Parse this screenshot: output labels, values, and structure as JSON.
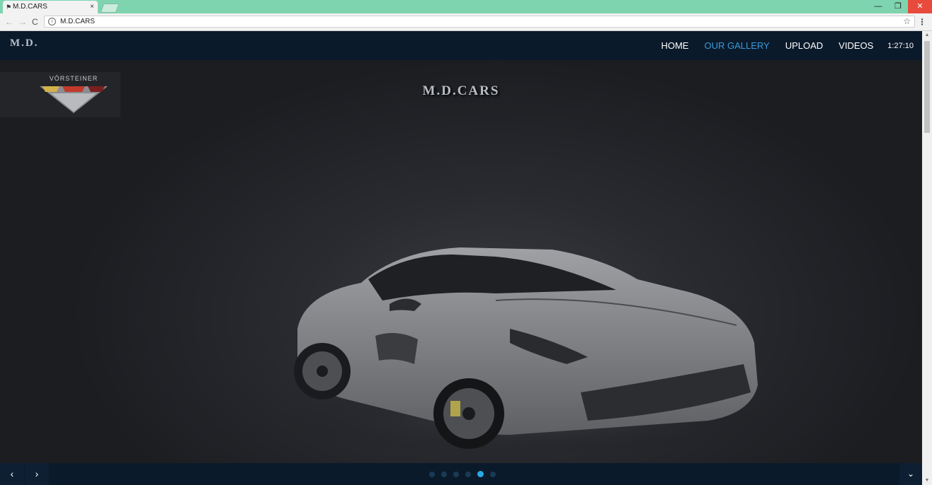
{
  "browser": {
    "tab_title": "M.D.CARS",
    "tab_close": "×",
    "url": "M.D.CARS",
    "back": "←",
    "forward": "→",
    "reload": "C",
    "star": "☆",
    "menu": "⋮",
    "minimize": "—",
    "restore": "❐",
    "close": "✕",
    "info": "i"
  },
  "site": {
    "brand": "M.D.",
    "nav": [
      {
        "label": "HOME",
        "active": false
      },
      {
        "label": "OUR GALLERY",
        "active": true
      },
      {
        "label": "UPLOAD",
        "active": false
      },
      {
        "label": "VIDEOS",
        "active": false
      }
    ],
    "clock": "1:27:10",
    "hero_title": "M.D.CARS",
    "badge_text": "VÖRSTEINER"
  },
  "slider": {
    "prev": "‹",
    "next": "›",
    "down": "⌄",
    "dot_count": 6,
    "active_dot": 5
  },
  "colors": {
    "header_bg": "#0b1a2b",
    "nav_active": "#3a9ad9",
    "dot_active": "#2aa8e6",
    "tabstrip": "#7fd4b0"
  }
}
